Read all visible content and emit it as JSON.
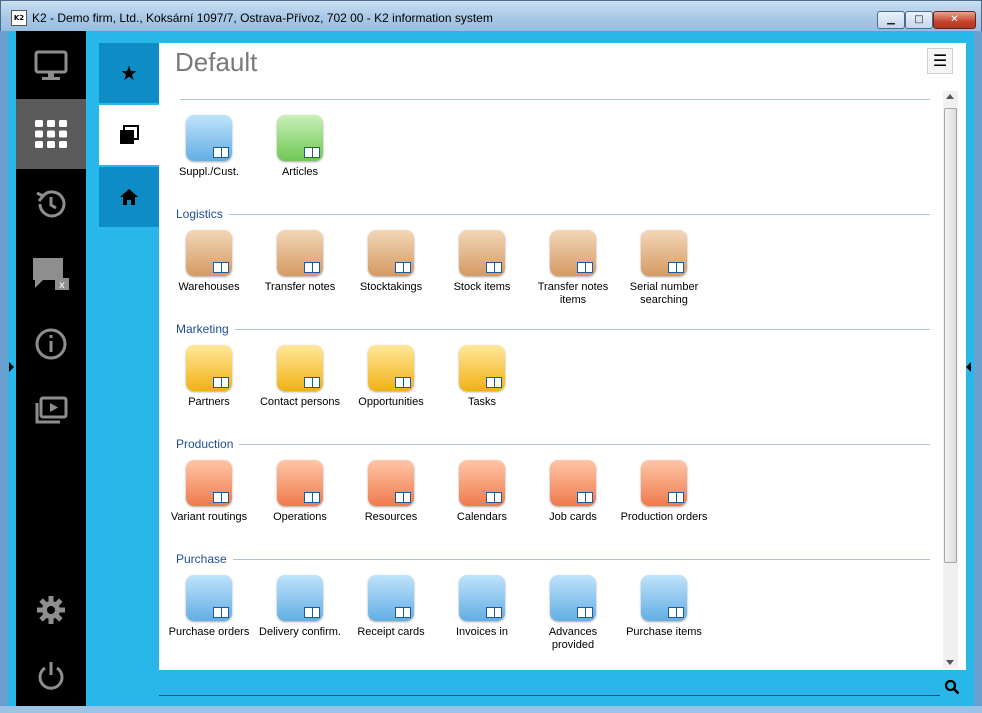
{
  "window": {
    "app_icon_text": "K2",
    "title": "K2 - Demo firm, Ltd., Koksární 1097/7, Ostrava-Přívoz, 702 00 - K2 information system",
    "minimize_glyph": "▁",
    "maximize_glyph": "□",
    "close_glyph": "✕"
  },
  "leftnav": {
    "items": [
      "monitor-icon",
      "apps-grid-icon",
      "history-icon",
      "chat-close-icon",
      "info-icon",
      "media-icon",
      "settings-icon",
      "power-icon"
    ],
    "active_index": 1
  },
  "tabs": {
    "items": [
      "star-icon",
      "windows-icon",
      "home-icon"
    ],
    "active_index": 1,
    "star_glyph": "★"
  },
  "page": {
    "title": "Default",
    "menu_glyph": "☰"
  },
  "sections": {
    "top": {
      "label": "",
      "items": [
        {
          "label": "Suppl./Cust.",
          "icon": "supplier-customer-icon",
          "color": "blue"
        },
        {
          "label": "Articles",
          "icon": "basket-icon",
          "color": "green"
        }
      ]
    },
    "logistics": {
      "label": "Logistics",
      "items": [
        {
          "label": "Warehouses",
          "icon": "forklift-icon",
          "color": "tan"
        },
        {
          "label": "Transfer notes",
          "icon": "documents-icon",
          "color": "tan"
        },
        {
          "label": "Stocktakings",
          "icon": "stocktaking-icon",
          "color": "tan"
        },
        {
          "label": "Stock items",
          "icon": "basket-icon",
          "color": "tan"
        },
        {
          "label": "Transfer notes items",
          "icon": "basket-icon",
          "color": "tan"
        },
        {
          "label": "Serial number searching",
          "icon": "forklift-search-icon",
          "color": "tan"
        }
      ]
    },
    "marketing": {
      "label": "Marketing",
      "items": [
        {
          "label": "Partners",
          "icon": "handshake-icon",
          "color": "yellow"
        },
        {
          "label": "Contact persons",
          "icon": "people-icon",
          "color": "yellow"
        },
        {
          "label": "Opportunities",
          "icon": "board-icon",
          "color": "yellow"
        },
        {
          "label": "Tasks",
          "icon": "notepad-icon",
          "color": "yellow"
        }
      ]
    },
    "production": {
      "label": "Production",
      "items": [
        {
          "label": "Variant routings",
          "icon": "routing-icon",
          "color": "salmon"
        },
        {
          "label": "Operations",
          "icon": "factory-icon",
          "color": "salmon"
        },
        {
          "label": "Resources",
          "icon": "factory-icon",
          "color": "salmon"
        },
        {
          "label": "Calendars",
          "icon": "calendar-icon",
          "color": "salmon"
        },
        {
          "label": "Job cards",
          "icon": "job-card-icon",
          "color": "salmon"
        },
        {
          "label": "Production orders",
          "icon": "production-order-icon",
          "color": "salmon"
        }
      ]
    },
    "purchase": {
      "label": "Purchase",
      "items": [
        {
          "label": "Purchase orders",
          "icon": "purchase-order-icon",
          "color": "blue"
        },
        {
          "label": "Delivery confirm.",
          "icon": "delivery-icon",
          "color": "blue"
        },
        {
          "label": "Receipt cards",
          "icon": "receipt-icon",
          "color": "blue"
        },
        {
          "label": "Invoices in",
          "icon": "invoice-icon",
          "color": "blue"
        },
        {
          "label": "Advances provided",
          "icon": "advance-icon",
          "color": "blue"
        },
        {
          "label": "Purchase items",
          "icon": "basket-icon",
          "color": "blue"
        }
      ]
    }
  },
  "search": {
    "placeholder": ""
  },
  "colors": {
    "accent": "#29b6e8",
    "nav_bg": "#000000",
    "section_label": "#1f4e99"
  }
}
